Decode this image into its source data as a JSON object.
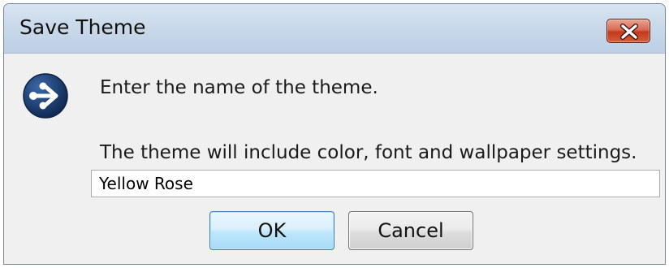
{
  "dialog": {
    "title": "Save Theme",
    "close_icon": "close-icon",
    "app_icon": "theme-arrow-icon",
    "prompt": "Enter the name of the theme.",
    "description": "The theme will include color, font and wallpaper settings.",
    "name_value": "Yellow Rose",
    "ok_label": "OK",
    "cancel_label": "Cancel"
  },
  "colors": {
    "title_bar": "#c9d9ea",
    "close_button": "#c4391c",
    "body_background": "#f0f0f0",
    "icon_blue": "#1d3f73",
    "ok_border": "#3c7fb1"
  }
}
